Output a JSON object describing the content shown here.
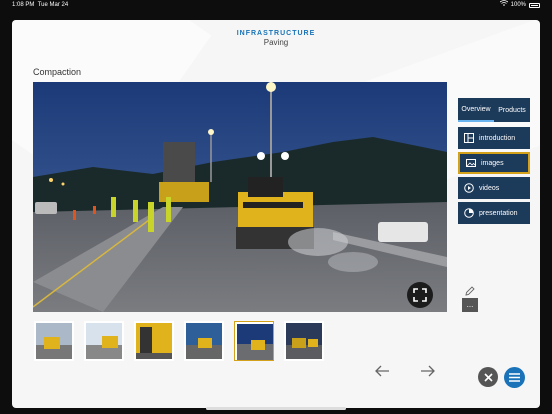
{
  "status": {
    "time": "1:08 PM",
    "date": "Tue Mar 24",
    "battery": "100%"
  },
  "header": {
    "category": "INFRASTRUCTURE",
    "subcategory": "Paving"
  },
  "title": "Compaction",
  "tabs": {
    "overview": "Overview",
    "products": "Products"
  },
  "menu": [
    {
      "label": "introduction",
      "icon": "introduction-icon"
    },
    {
      "label": "images",
      "icon": "images-icon",
      "selected": true
    },
    {
      "label": "videos",
      "icon": "videos-icon"
    },
    {
      "label": "presentation",
      "icon": "presentation-icon"
    }
  ],
  "more_label": "...",
  "thumbnails": [
    {
      "name": "thumbnail-1"
    },
    {
      "name": "thumbnail-2"
    },
    {
      "name": "thumbnail-3"
    },
    {
      "name": "thumbnail-4"
    },
    {
      "name": "thumbnail-5",
      "selected": true
    },
    {
      "name": "thumbnail-6"
    }
  ],
  "colors": {
    "accent": "#1a73b8",
    "selected_outline": "#d4a21a",
    "menu_bg": "#1c3a5a"
  }
}
